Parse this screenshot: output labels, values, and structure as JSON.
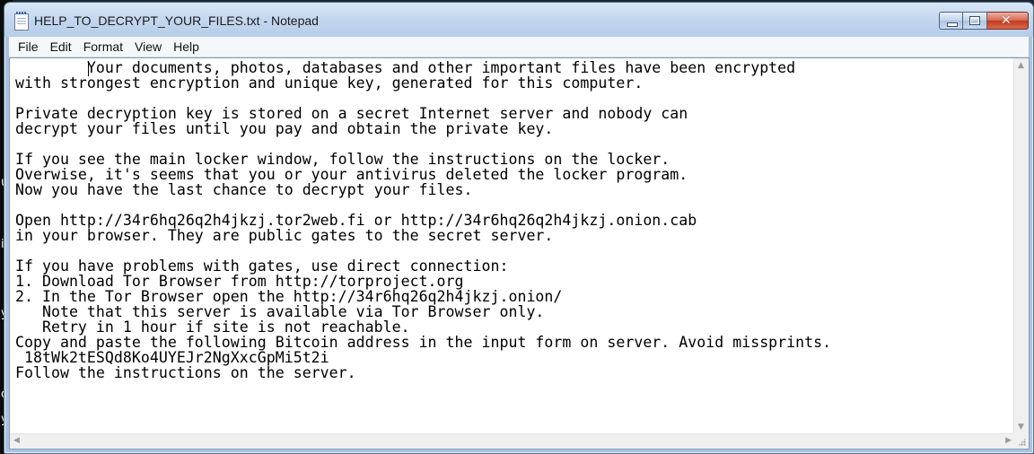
{
  "window": {
    "title": "HELP_TO_DECRYPT_YOUR_FILES.txt - Notepad",
    "icon": "notepad-icon"
  },
  "menu": [
    "File",
    "Edit",
    "Format",
    "View",
    "Help"
  ],
  "caption_buttons": {
    "minimize": "minimize-icon",
    "maximize": "maximize-icon",
    "close": "close-icon",
    "close_glyph": "✕"
  },
  "document": {
    "text": "        Your documents, photos, databases and other important files have been encrypted\nwith strongest encryption and unique key, generated for this computer.\n\nPrivate decryption key is stored on a secret Internet server and nobody can\ndecrypt your files until you pay and obtain the private key.\n\nIf you see the main locker window, follow the instructions on the locker.\nOverwise, it's seems that you or your antivirus deleted the locker program.\nNow you have the last chance to decrypt your files.\n\nOpen http://34r6hq26q2h4jkzj.tor2web.fi or http://34r6hq26q2h4jkzj.onion.cab\nin your browser. They are public gates to the secret server.\n\nIf you have problems with gates, use direct connection:\n1. Download Tor Browser from http://torproject.org\n2. In the Tor Browser open the http://34r6hq26q2h4jkzj.onion/\n   Note that this server is available via Tor Browser only.\n   Retry in 1 hour if site is not reachable.\nCopy and paste the following Bitcoin address in the input form on server. Avoid missprints.\n 18tWk2tESQd8Ko4UYEJr2NgXxcGpMi5t2i\nFollow the instructions on the server."
  },
  "background_fragments": [
    "u",
    "i",
    "y",
    "o",
    "y"
  ],
  "scroll_arrows": {
    "up": "▲",
    "down": "▼",
    "left": "◀",
    "right": "▶"
  },
  "colors": {
    "titlebar": "#c4d8ef",
    "close_button": "#d8644b",
    "editor_bg": "#ffffff"
  }
}
